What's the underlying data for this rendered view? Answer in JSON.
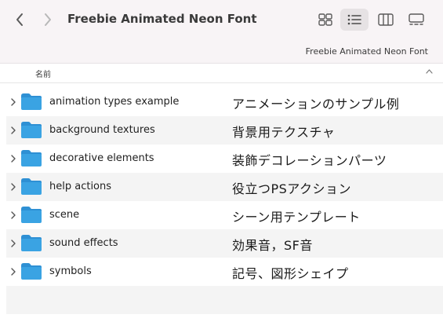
{
  "window": {
    "title": "Freebie Animated Neon Font",
    "path": "Freebie Animated Neon Font"
  },
  "toolbar": {
    "back_icon": "chevron-left-icon",
    "forward_icon": "chevron-right-icon",
    "views": [
      "icon-view",
      "list-view",
      "column-view",
      "gallery-view"
    ],
    "active_view": "list-view"
  },
  "columns": {
    "name": "名前"
  },
  "items": [
    {
      "name": "animation types example",
      "label": "アニメーションのサンプル例"
    },
    {
      "name": "background textures",
      "label": "背景用テクスチャ"
    },
    {
      "name": "decorative elements",
      "label": "装飾デコレーションパーツ"
    },
    {
      "name": "help actions",
      "label": "役立つPSアクション"
    },
    {
      "name": "scene",
      "label": "シーン用テンプレート"
    },
    {
      "name": "sound effects",
      "label": "効果音，SF音"
    },
    {
      "name": "symbols",
      "label": "記号、図形シェイプ"
    }
  ],
  "colors": {
    "toolbar_bg": "#f8f4f6",
    "folder_blue": "#3aa3e3",
    "stripe": "#f4f4f4"
  }
}
